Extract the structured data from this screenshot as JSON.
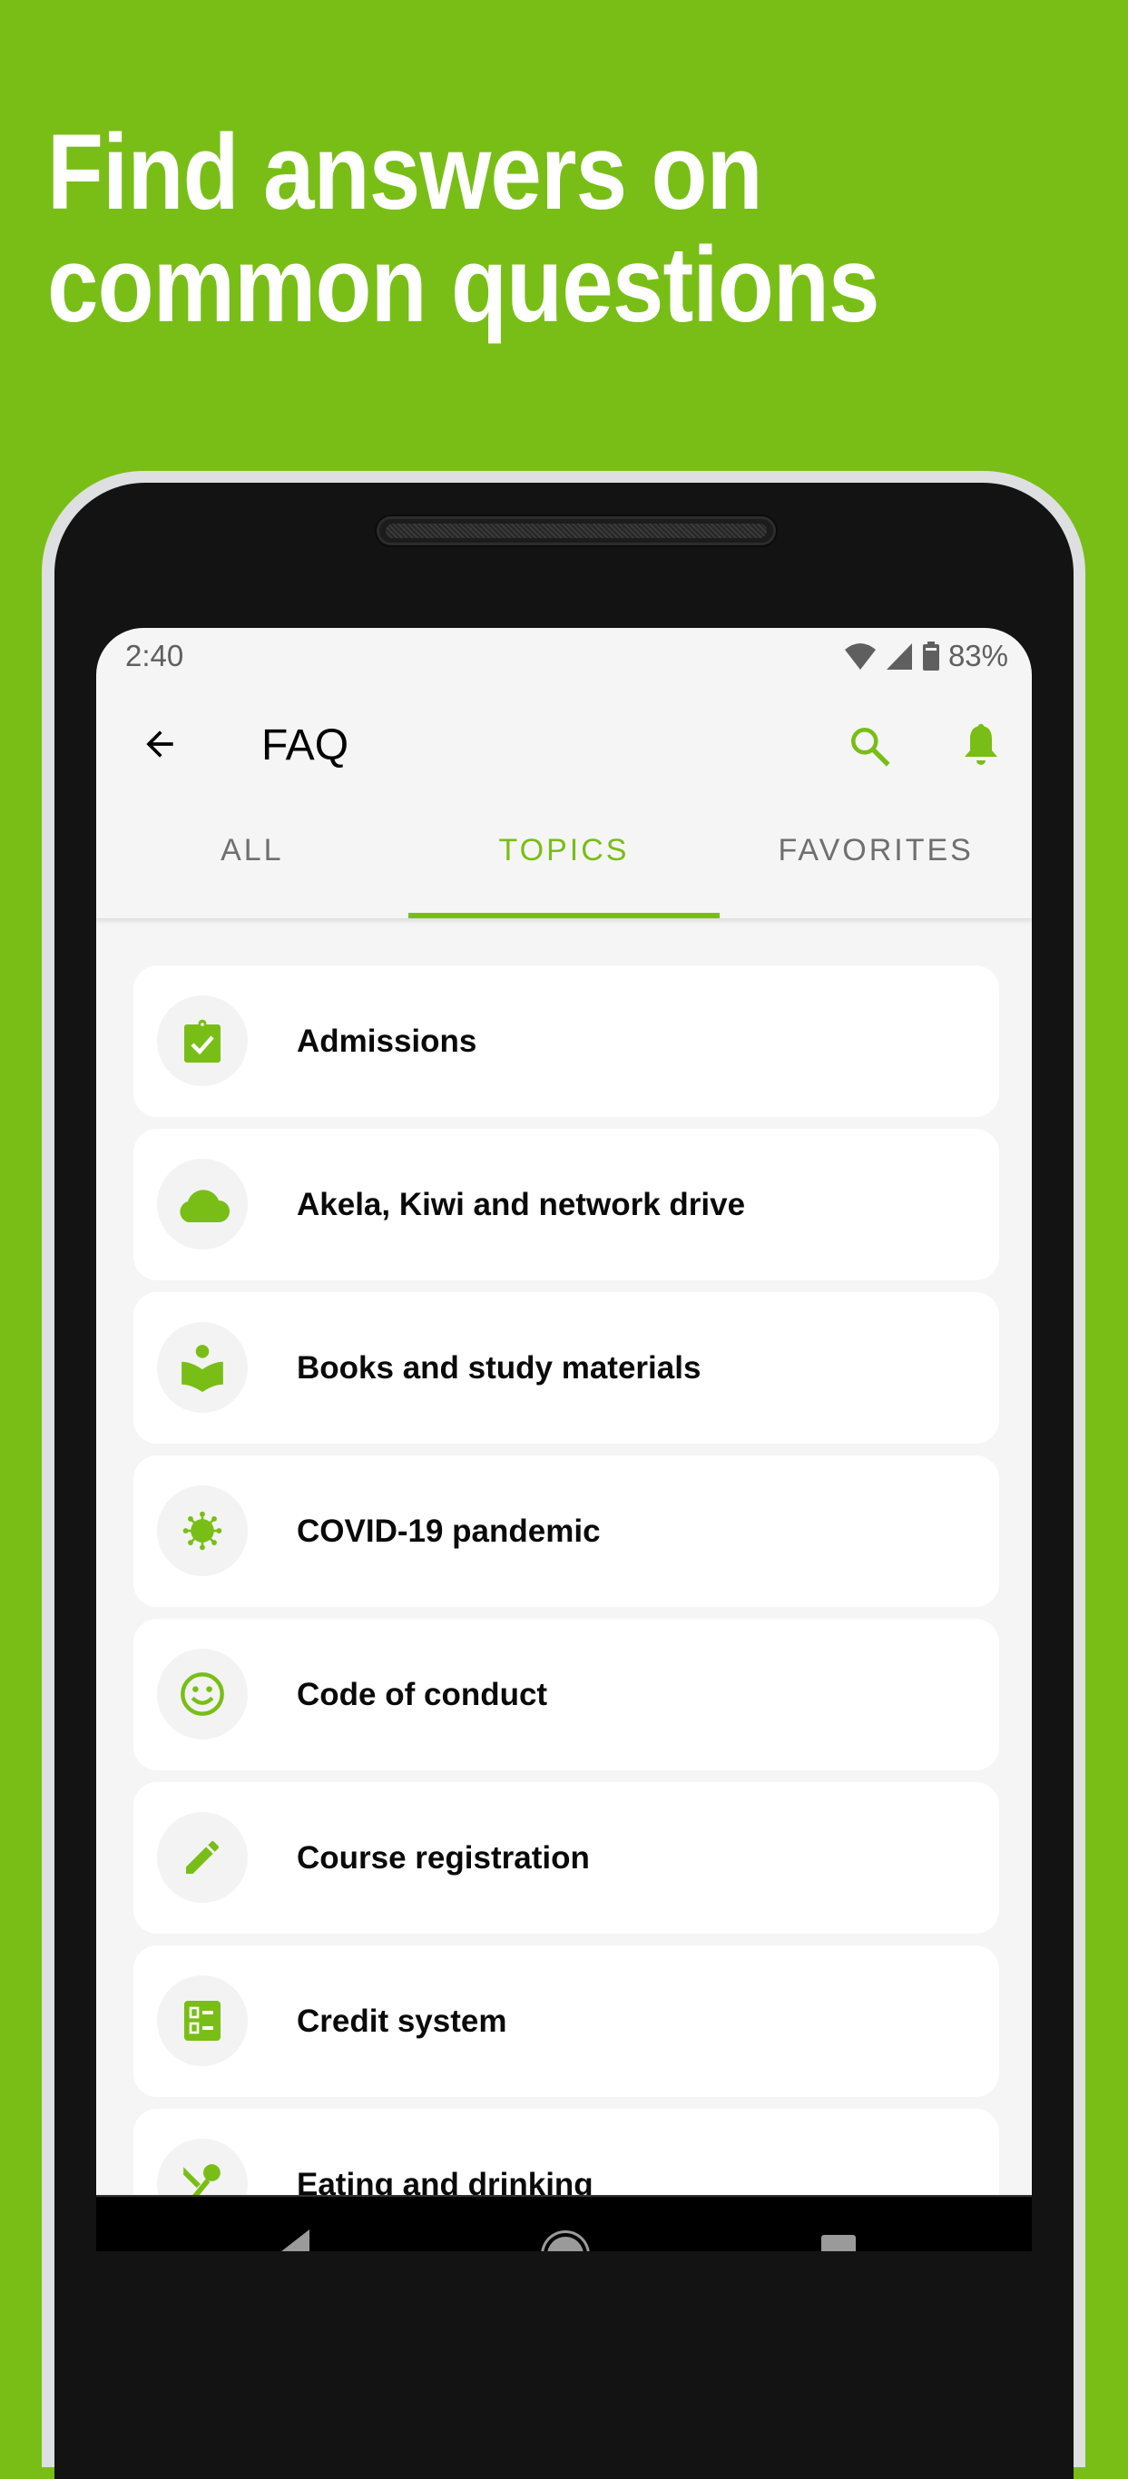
{
  "headline": {
    "line1": "Find answers on",
    "line2": "common questions"
  },
  "status_bar": {
    "time": "2:40",
    "battery": "83%",
    "icons": [
      "wifi-icon",
      "cell-signal-icon",
      "battery-icon"
    ]
  },
  "app_bar": {
    "title": "FAQ",
    "back_icon": "arrow-back-icon",
    "actions": [
      "search-icon",
      "bell-icon"
    ]
  },
  "tabs": [
    {
      "label": "ALL",
      "active": false
    },
    {
      "label": "TOPICS",
      "active": true
    },
    {
      "label": "FAVORITES",
      "active": false
    }
  ],
  "topics": [
    {
      "label": "Admissions",
      "icon": "clipboard-check-icon"
    },
    {
      "label": "Akela, Kiwi and network drive",
      "icon": "cloud-icon"
    },
    {
      "label": "Books and study materials",
      "icon": "reading-book-icon"
    },
    {
      "label": "COVID-19 pandemic",
      "icon": "virus-icon"
    },
    {
      "label": "Code of conduct",
      "icon": "smiley-icon"
    },
    {
      "label": "Course registration",
      "icon": "pencil-icon"
    },
    {
      "label": "Credit system",
      "icon": "checklist-icon"
    },
    {
      "label": "Eating and drinking",
      "icon": "restaurant-icon"
    }
  ],
  "nav_bar": {
    "buttons": [
      "nav-back-icon",
      "nav-home-icon",
      "nav-recents-icon"
    ]
  },
  "colors": {
    "accent": "#79BE16",
    "background": "#79BE16",
    "screen_bg": "#F5F5F5",
    "card_bg": "#FFFFFF"
  }
}
